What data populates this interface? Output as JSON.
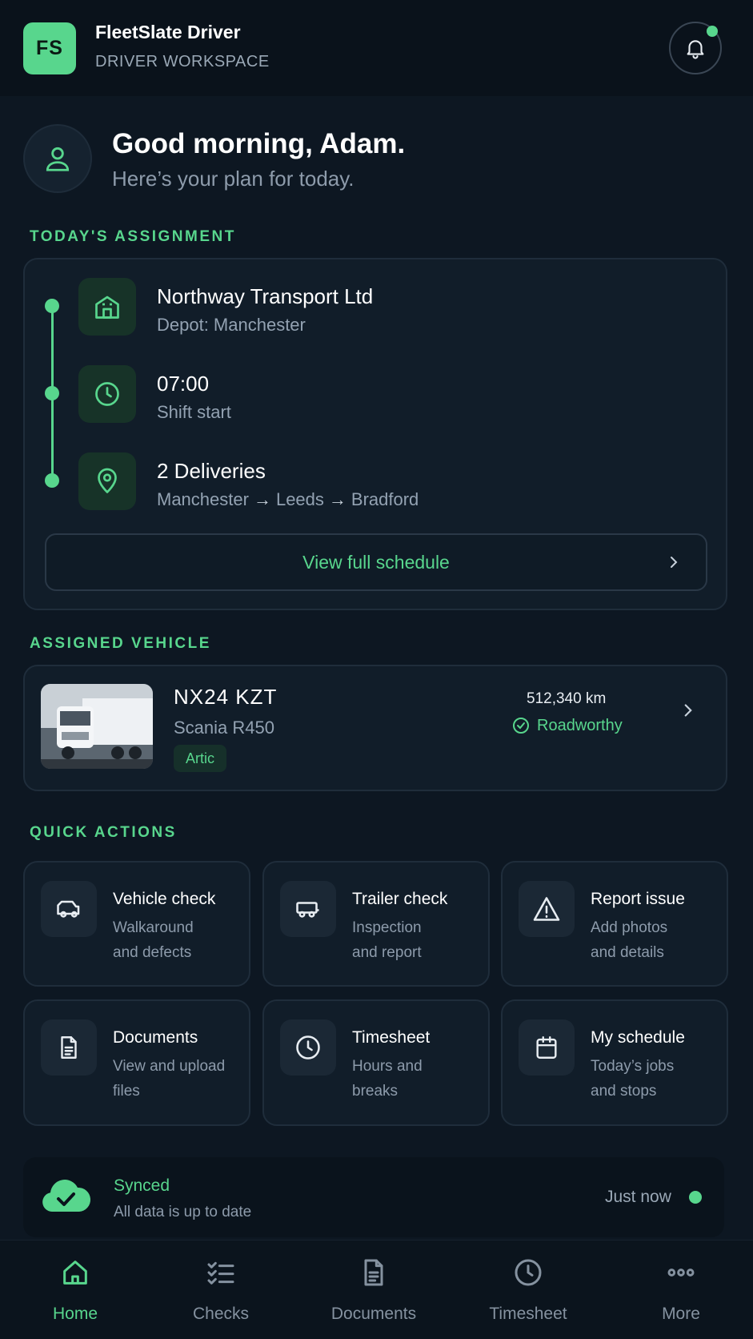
{
  "header": {
    "logo_text": "FS",
    "app_name": "FleetSlate Driver",
    "subtitle": "DRIVER WORKSPACE",
    "notification_indicator": true
  },
  "greeting": {
    "title": "Good morning, Adam.",
    "subtitle": "Here’s your plan for today."
  },
  "assignment": {
    "section_title": "TODAY'S ASSIGNMENT",
    "items": [
      {
        "icon": "building-icon",
        "title": "Northway Transport Ltd",
        "subtitle": "Depot: Manchester"
      },
      {
        "icon": "clock-icon",
        "title": "07:00",
        "subtitle": "Shift start"
      },
      {
        "icon": "location-pin-icon",
        "title": "2 Deliveries",
        "route": [
          "Manchester",
          "Leeds",
          "Bradford"
        ]
      }
    ],
    "button_label": "View full schedule"
  },
  "vehicle": {
    "section_title": "ASSIGNED VEHICLE",
    "plate": "NX24 KZT",
    "model": "Scania R450",
    "type_tag": "Artic",
    "odometer": "512,340 km",
    "status": "Roadworthy"
  },
  "quick_actions": {
    "section_title": "QUICK ACTIONS",
    "items": [
      {
        "icon": "van-icon",
        "title": "Vehicle check",
        "line1": "Walkaround",
        "line2": "and defects"
      },
      {
        "icon": "trailer-icon",
        "title": "Trailer check",
        "line1": "Inspection",
        "line2": "and report"
      },
      {
        "icon": "warning-icon",
        "title": "Report issue",
        "line1": "Add photos",
        "line2": "and details"
      },
      {
        "icon": "document-icon",
        "title": "Documents",
        "line1": "View and upload",
        "line2": "files"
      },
      {
        "icon": "clock-icon",
        "title": "Timesheet",
        "line1": "Hours and",
        "line2": "breaks"
      },
      {
        "icon": "calendar-icon",
        "title": "My schedule",
        "line1": "Today’s jobs",
        "line2": "and stops"
      }
    ]
  },
  "sync": {
    "title": "Synced",
    "subtitle": "All data is up to date",
    "time": "Just now"
  },
  "nav": {
    "items": [
      {
        "label": "Home",
        "icon": "home-icon",
        "active": true
      },
      {
        "label": "Checks",
        "icon": "checklist-icon",
        "active": false
      },
      {
        "label": "Documents",
        "icon": "document-icon",
        "active": false
      },
      {
        "label": "Timesheet",
        "icon": "clock-icon",
        "active": false
      },
      {
        "label": "More",
        "icon": "more-icon",
        "active": false
      }
    ]
  },
  "colors": {
    "accent": "#58d68d",
    "background": "#0d1722",
    "card": "#111d29"
  }
}
